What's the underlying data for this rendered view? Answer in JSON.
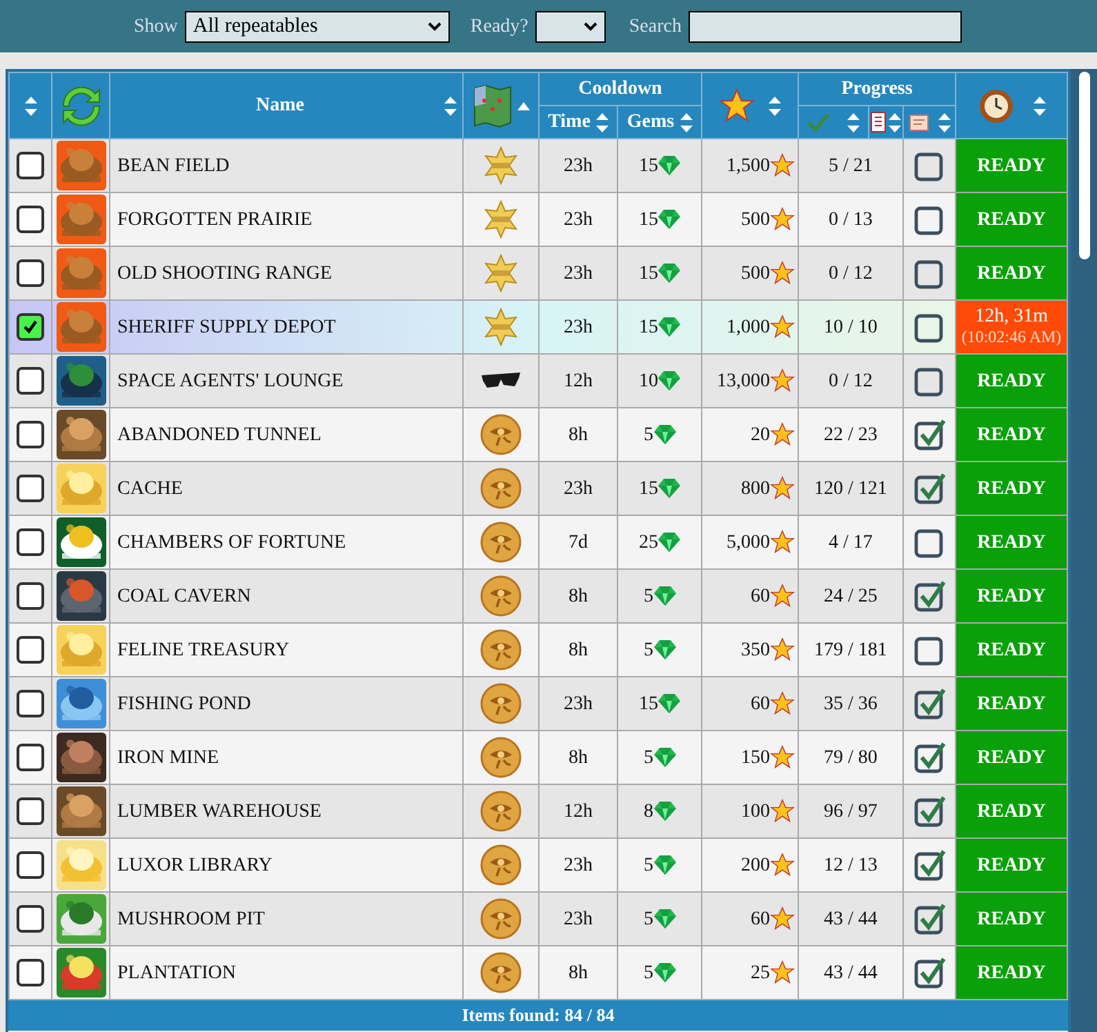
{
  "filters": {
    "show": {
      "label": "Show",
      "value": "All repeatables"
    },
    "ready": {
      "label": "Ready?"
    },
    "search": {
      "label": "Search"
    }
  },
  "table": {
    "columns": {
      "name": "Name",
      "cooldown": "Cooldown",
      "time": "Time",
      "gems": "Gems",
      "progress": "Progress"
    },
    "rows": [
      {
        "selected": false,
        "region": {
          "kind": "sheriff"
        },
        "name": "BEAN FIELD",
        "time": "23h",
        "gems": "15",
        "stars": "1,500",
        "progress": "5 / 21",
        "done": false,
        "status": {
          "kind": "ready",
          "text": "READY"
        }
      },
      {
        "selected": false,
        "region": {
          "kind": "sheriff"
        },
        "name": "FORGOTTEN PRAIRIE",
        "time": "23h",
        "gems": "15",
        "stars": "500",
        "progress": "0 / 13",
        "done": false,
        "status": {
          "kind": "ready",
          "text": "READY"
        }
      },
      {
        "selected": false,
        "region": {
          "kind": "sheriff"
        },
        "name": "OLD SHOOTING RANGE",
        "time": "23h",
        "gems": "15",
        "stars": "500",
        "progress": "0 / 12",
        "done": false,
        "status": {
          "kind": "ready",
          "text": "READY"
        }
      },
      {
        "selected": true,
        "region": {
          "kind": "sheriff"
        },
        "name": "SHERIFF SUPPLY DEPOT",
        "time": "23h",
        "gems": "15",
        "stars": "1,000",
        "progress": "10 / 10",
        "done": false,
        "status": {
          "kind": "timer",
          "text": "12h, 31m",
          "sub": "(10:02:46 AM)"
        }
      },
      {
        "selected": false,
        "region": {
          "kind": "shades"
        },
        "name": "SPACE AGENTS' LOUNGE",
        "time": "12h",
        "gems": "10",
        "stars": "13,000",
        "progress": "0 / 12",
        "done": false,
        "status": {
          "kind": "ready",
          "text": "READY"
        }
      },
      {
        "selected": false,
        "region": {
          "kind": "eye"
        },
        "name": "ABANDONED TUNNEL",
        "time": "8h",
        "gems": "5",
        "stars": "20",
        "progress": "22 / 23",
        "done": true,
        "status": {
          "kind": "ready",
          "text": "READY"
        }
      },
      {
        "selected": false,
        "region": {
          "kind": "eye"
        },
        "name": "CACHE",
        "time": "23h",
        "gems": "15",
        "stars": "800",
        "progress": "120 / 121",
        "done": true,
        "status": {
          "kind": "ready",
          "text": "READY"
        }
      },
      {
        "selected": false,
        "region": {
          "kind": "eye"
        },
        "name": "CHAMBERS OF FORTUNE",
        "time": "7d",
        "gems": "25",
        "stars": "5,000",
        "progress": "4 / 17",
        "done": false,
        "status": {
          "kind": "ready",
          "text": "READY"
        }
      },
      {
        "selected": false,
        "region": {
          "kind": "eye"
        },
        "name": "COAL CAVERN",
        "time": "8h",
        "gems": "5",
        "stars": "60",
        "progress": "24 / 25",
        "done": true,
        "status": {
          "kind": "ready",
          "text": "READY"
        }
      },
      {
        "selected": false,
        "region": {
          "kind": "eye"
        },
        "name": "FELINE TREASURY",
        "time": "8h",
        "gems": "5",
        "stars": "350",
        "progress": "179 / 181",
        "done": false,
        "status": {
          "kind": "ready",
          "text": "READY"
        }
      },
      {
        "selected": false,
        "region": {
          "kind": "eye"
        },
        "name": "FISHING POND",
        "time": "23h",
        "gems": "15",
        "stars": "60",
        "progress": "35 / 36",
        "done": true,
        "status": {
          "kind": "ready",
          "text": "READY"
        }
      },
      {
        "selected": false,
        "region": {
          "kind": "eye"
        },
        "name": "IRON MINE",
        "time": "8h",
        "gems": "5",
        "stars": "150",
        "progress": "79 / 80",
        "done": true,
        "status": {
          "kind": "ready",
          "text": "READY"
        }
      },
      {
        "selected": false,
        "region": {
          "kind": "eye"
        },
        "name": "LUMBER WAREHOUSE",
        "time": "12h",
        "gems": "8",
        "stars": "100",
        "progress": "96 / 97",
        "done": true,
        "status": {
          "kind": "ready",
          "text": "READY"
        }
      },
      {
        "selected": false,
        "region": {
          "kind": "eye"
        },
        "name": "LUXOR LIBRARY",
        "time": "23h",
        "gems": "5",
        "stars": "200",
        "progress": "12 / 13",
        "done": true,
        "status": {
          "kind": "ready",
          "text": "READY"
        }
      },
      {
        "selected": false,
        "region": {
          "kind": "eye"
        },
        "name": "MUSHROOM PIT",
        "time": "23h",
        "gems": "5",
        "stars": "60",
        "progress": "43 / 44",
        "done": true,
        "status": {
          "kind": "ready",
          "text": "READY"
        }
      },
      {
        "selected": false,
        "region": {
          "kind": "eye"
        },
        "name": "PLANTATION",
        "time": "8h",
        "gems": "5",
        "stars": "25",
        "progress": "43 / 44",
        "done": true,
        "status": {
          "kind": "ready",
          "text": "READY"
        }
      }
    ],
    "footer": "Items found: 84 / 84"
  }
}
